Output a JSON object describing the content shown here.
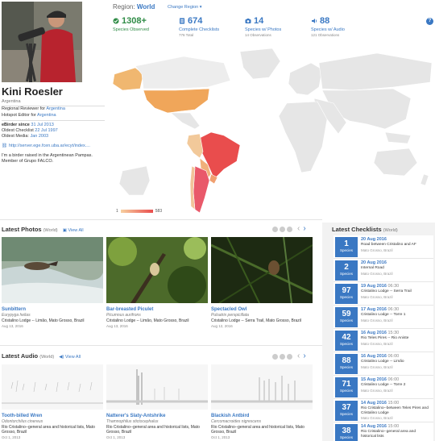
{
  "profile": {
    "name": "Kini Roesler",
    "country": "Argentina",
    "regional_reviewer_prefix": "Regional Reviewer for ",
    "regional_reviewer_region": "Argentina",
    "hotspot_editor_prefix": "Hotspot Editor for ",
    "hotspot_editor_region": "Argentina",
    "ebirder_since_label": "eBirder since",
    "ebirder_since": "31 Jul 2013",
    "oldest_checklist_label": "Oldest Checklist",
    "oldest_checklist": "22 Jul 1997",
    "oldest_media_label": "Oldest Media",
    "oldest_media": "Jan 2003",
    "url": "http://server.ege.fcen.uba.ar/ecyt/index....",
    "bio": "I'm a birder raised in the Argentinean Pampas. Member of Grupo FALCO."
  },
  "header": {
    "region_label": "Region:",
    "region_name": "World",
    "change_region": "Change Region ▾",
    "help": "?"
  },
  "stats": [
    {
      "num": "1308+",
      "label": "Species Observed",
      "sub": "",
      "icon": "check-circle-icon"
    },
    {
      "num": "674",
      "label": "Complete Checklists",
      "sub": "776 Total",
      "icon": "checklist-icon"
    },
    {
      "num": "14",
      "label": "Species w/ Photos",
      "sub": "14 Observations",
      "icon": "camera-icon"
    },
    {
      "num": "88",
      "label": "Species w/ Audio",
      "sub": "121 Observations",
      "icon": "audio-icon"
    }
  ],
  "map_legend": {
    "min": "1",
    "max": "583"
  },
  "colors": {
    "accent": "#3a78c3",
    "green": "#2e8b45",
    "map_low": "#f7d0a0",
    "map_high": "#e94d4d",
    "land": "#e6e6e6"
  },
  "photos": {
    "title": "Latest Photos",
    "scope": "(World)",
    "view_all": "View All",
    "items": [
      {
        "title": "Sunbittern",
        "sci": "Eurypyga helias",
        "loc": "Cristalino Lodge -- Limão, Mato Grosso, Brazil",
        "date": "Aug 13, 2016"
      },
      {
        "title": "Bar-breasted Piculet",
        "sci": "Picumnus aurifrons",
        "loc": "Cristalino Lodge -- Limão, Mato Grosso, Brazil",
        "date": "Aug 13, 2016"
      },
      {
        "title": "Spectacled Owl",
        "sci": "Pulsatrix perspicillata",
        "loc": "Cristalino Lodge -- Serra Trail, Mato Grosso, Brazil",
        "date": "Aug 12, 2016"
      }
    ]
  },
  "audio": {
    "title": "Latest Audio",
    "scope": "(World)",
    "view_all": "View All",
    "items": [
      {
        "title": "Tooth-billed Wren",
        "sci": "Odontorchilus cinereus",
        "loc": "Rio Cristalino--general area and historical lists, Mato Grosso, Brazil",
        "date": "Oct 1, 2013"
      },
      {
        "title": "Natterer's Slaty-Antshrike",
        "sci": "Thamnophilus stictocephalus",
        "loc": "Rio Cristalino--general area and historical lists, Mato Grosso, Brazil",
        "date": "Oct 1, 2013"
      },
      {
        "title": "Blackish Antbird",
        "sci": "Cercomacroides nigrescens",
        "loc": "Rio Cristalino--general area and historical lists, Mato Grosso, Brazil",
        "date": "Oct 1, 2013"
      }
    ]
  },
  "checklists": {
    "title": "Latest Checklists",
    "scope": "(World)",
    "species_word": "Species",
    "items": [
      {
        "count": "1",
        "date": "20 Aug 2016",
        "time": "",
        "place": "Road between Cristalino and AF",
        "region": "Mato Grosso, Brazil"
      },
      {
        "count": "2",
        "date": "20 Aug 2016",
        "time": "",
        "place": "Internal Road",
        "region": "Mato Grosso, Brazil"
      },
      {
        "count": "97",
        "date": "19 Aug 2016",
        "time": "06:30",
        "place": "Cristalino Lodge -- Serra Trail",
        "region": "Mato Grosso, Brazil"
      },
      {
        "count": "59",
        "date": "17 Aug 2016",
        "time": "06:30",
        "place": "Cristalino Lodge -- Torre 1",
        "region": "Mato Grosso, Brazil"
      },
      {
        "count": "42",
        "date": "16 Aug 2016",
        "time": "15:30",
        "place": "Rio Teles Pires -- Rio Aniste",
        "region": "Mato Grosso, Brazil"
      },
      {
        "count": "88",
        "date": "16 Aug 2016",
        "time": "06:00",
        "place": "Cristalino Lodge -- Limão",
        "region": "Mato Grosso, Brazil"
      },
      {
        "count": "71",
        "date": "15 Aug 2016",
        "time": "06:00",
        "place": "Cristalino Lodge -- Torre 2",
        "region": "Mato Grosso, Brazil"
      },
      {
        "count": "37",
        "date": "14 Aug 2016",
        "time": "15:00",
        "place": "Rio Cristalino--between Teles Pires and Cristalino Lodge",
        "region": "Mato Grosso, Brazil"
      },
      {
        "count": "38",
        "date": "14 Aug 2016",
        "time": "15:00",
        "place": "Rio Cristalino--general area and historical lists",
        "region": ""
      }
    ]
  }
}
